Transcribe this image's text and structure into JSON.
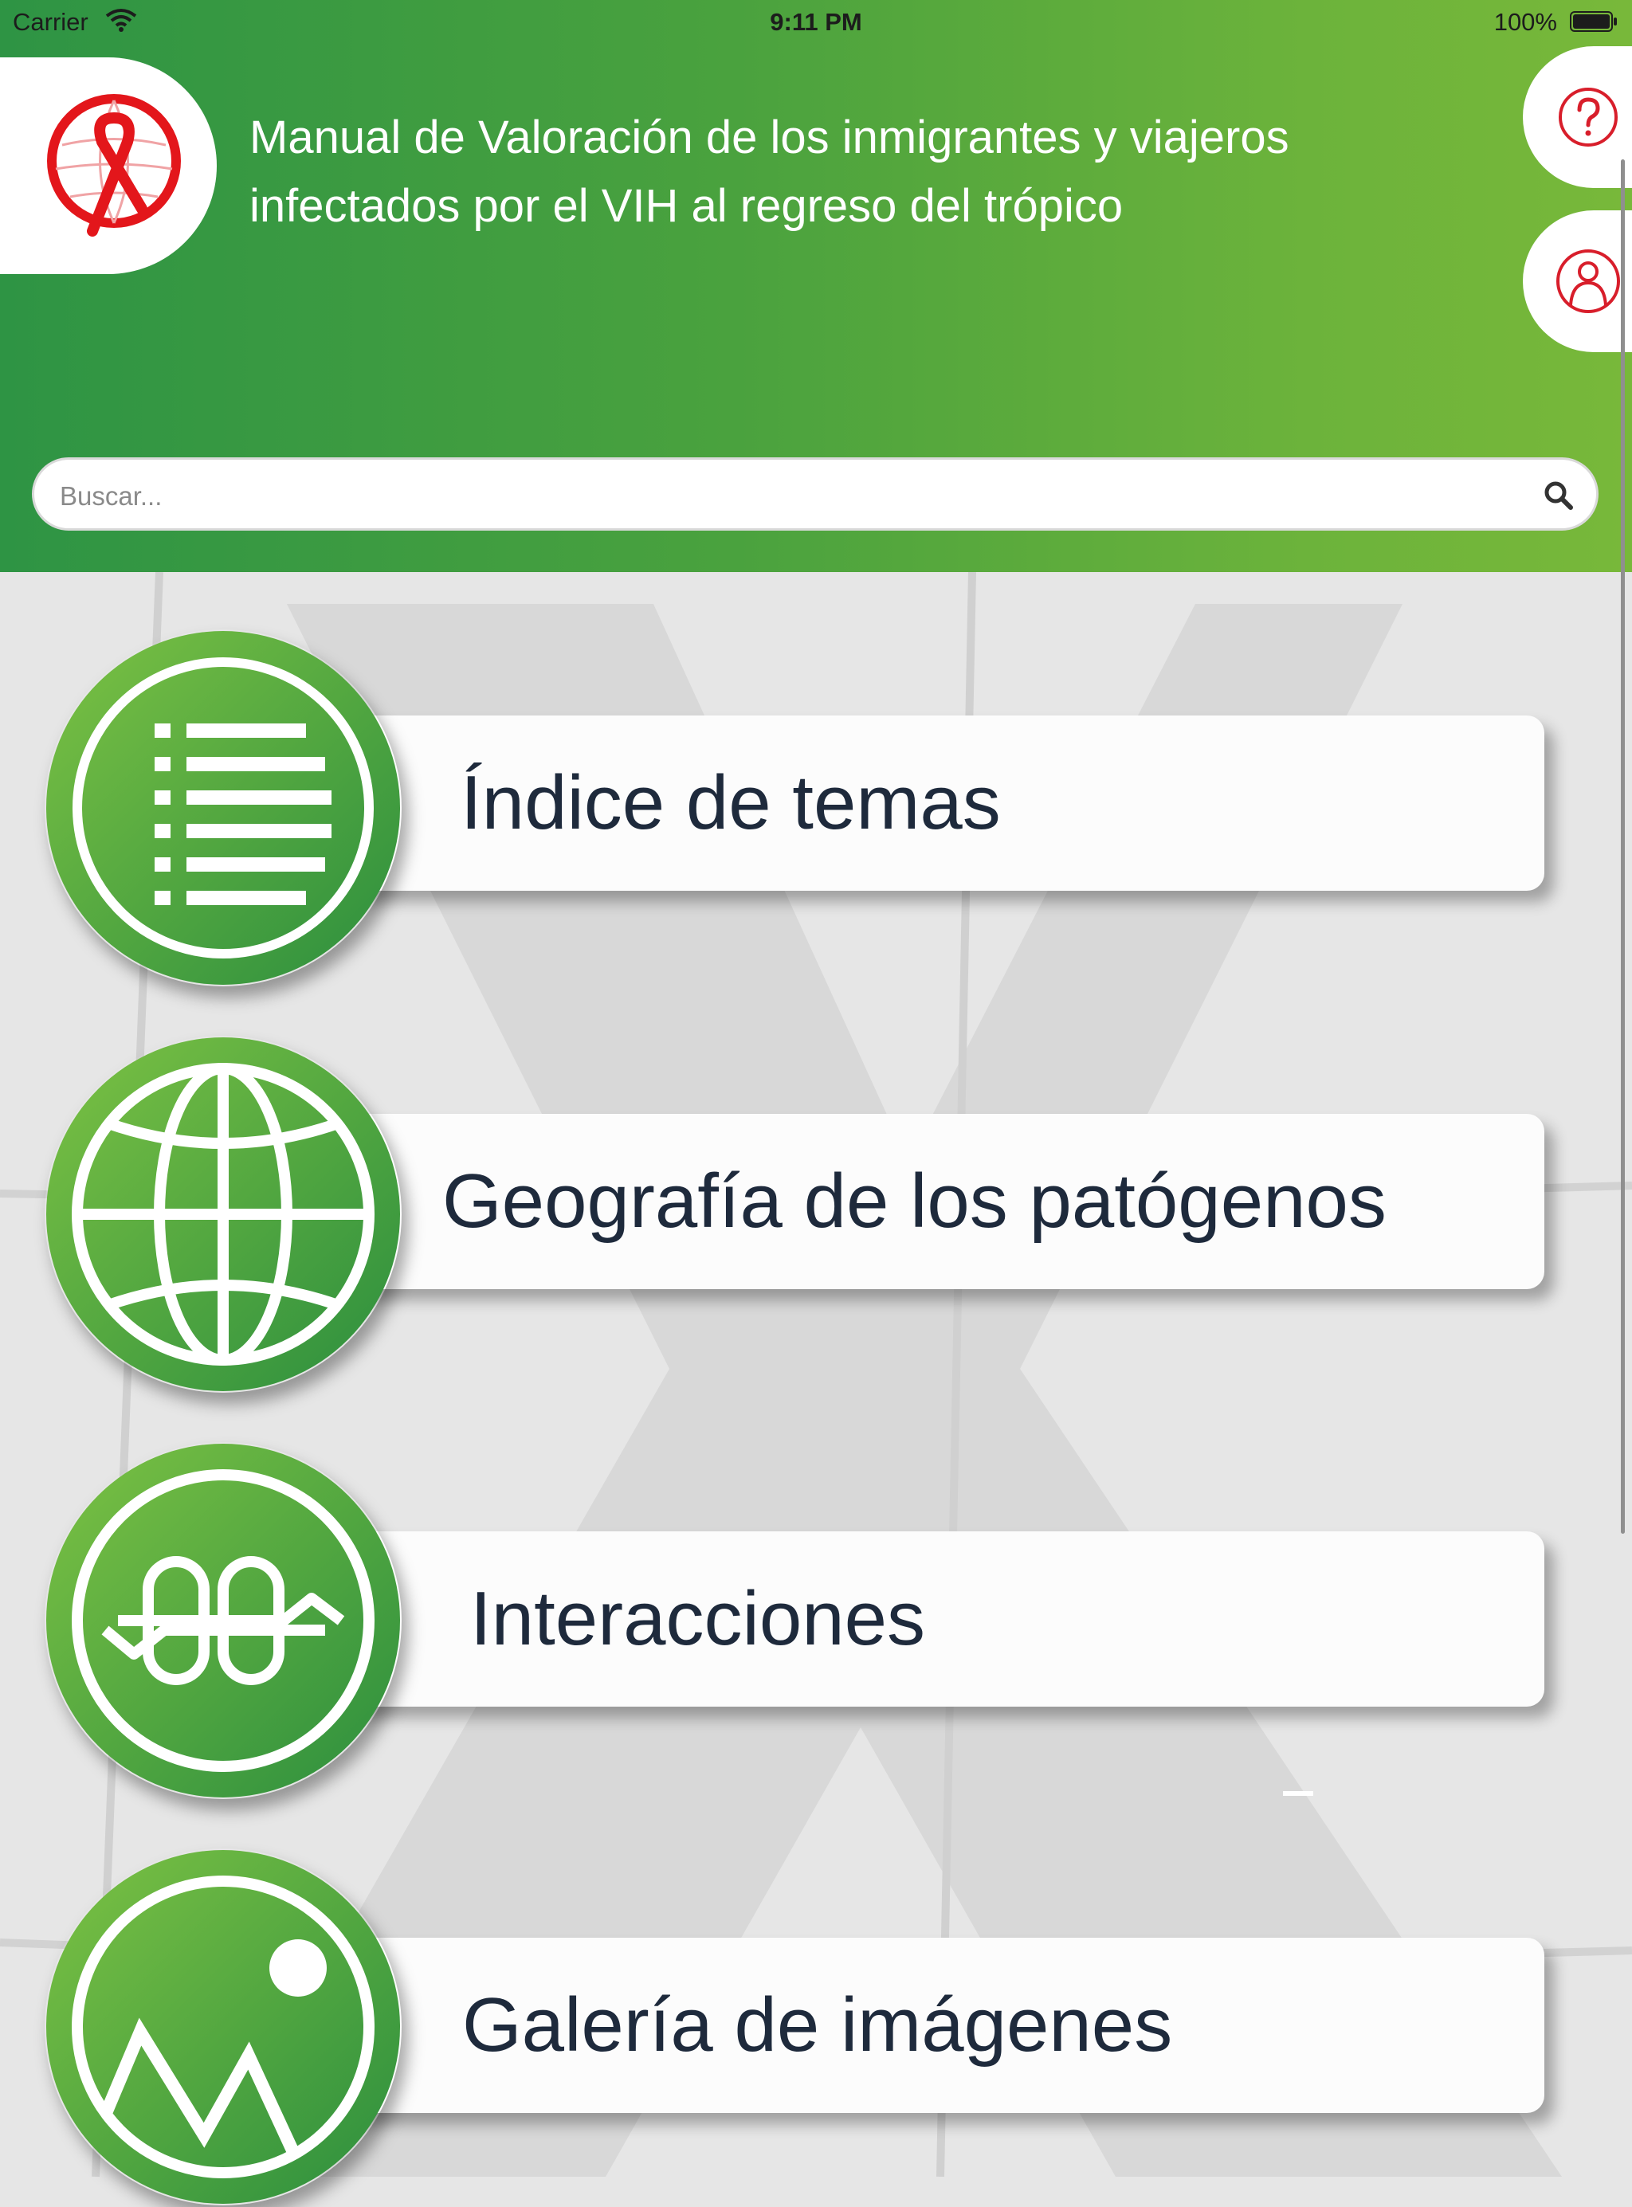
{
  "status_bar": {
    "carrier": "Carrier",
    "time": "9:11 PM",
    "battery": "100%"
  },
  "header": {
    "logo_icon": "hiv-ribbon-globe-logo",
    "title_line1": "Manual de Valoración de los inmigrantes y viajeros",
    "title_line2": "infectados por el VIH al regreso del trópico",
    "help_icon": "question-circle-icon",
    "user_icon": "user-profile-icon"
  },
  "search": {
    "placeholder": "Buscar...",
    "icon": "search-icon"
  },
  "menu": [
    {
      "label": "Índice de temas",
      "icon": "list-index-icon"
    },
    {
      "label": "Geografía de los patógenos",
      "icon": "globe-icon"
    },
    {
      "label": "Interacciones",
      "icon": "interactions-icon"
    },
    {
      "label": "Galería de imágenes",
      "icon": "image-gallery-icon"
    }
  ],
  "colors": {
    "header_green_dark": "#2e9444",
    "header_green_light": "#78b83a",
    "logo_red": "#e3161b",
    "card_text": "#1e2a3c",
    "background": "#e6e6e6"
  }
}
